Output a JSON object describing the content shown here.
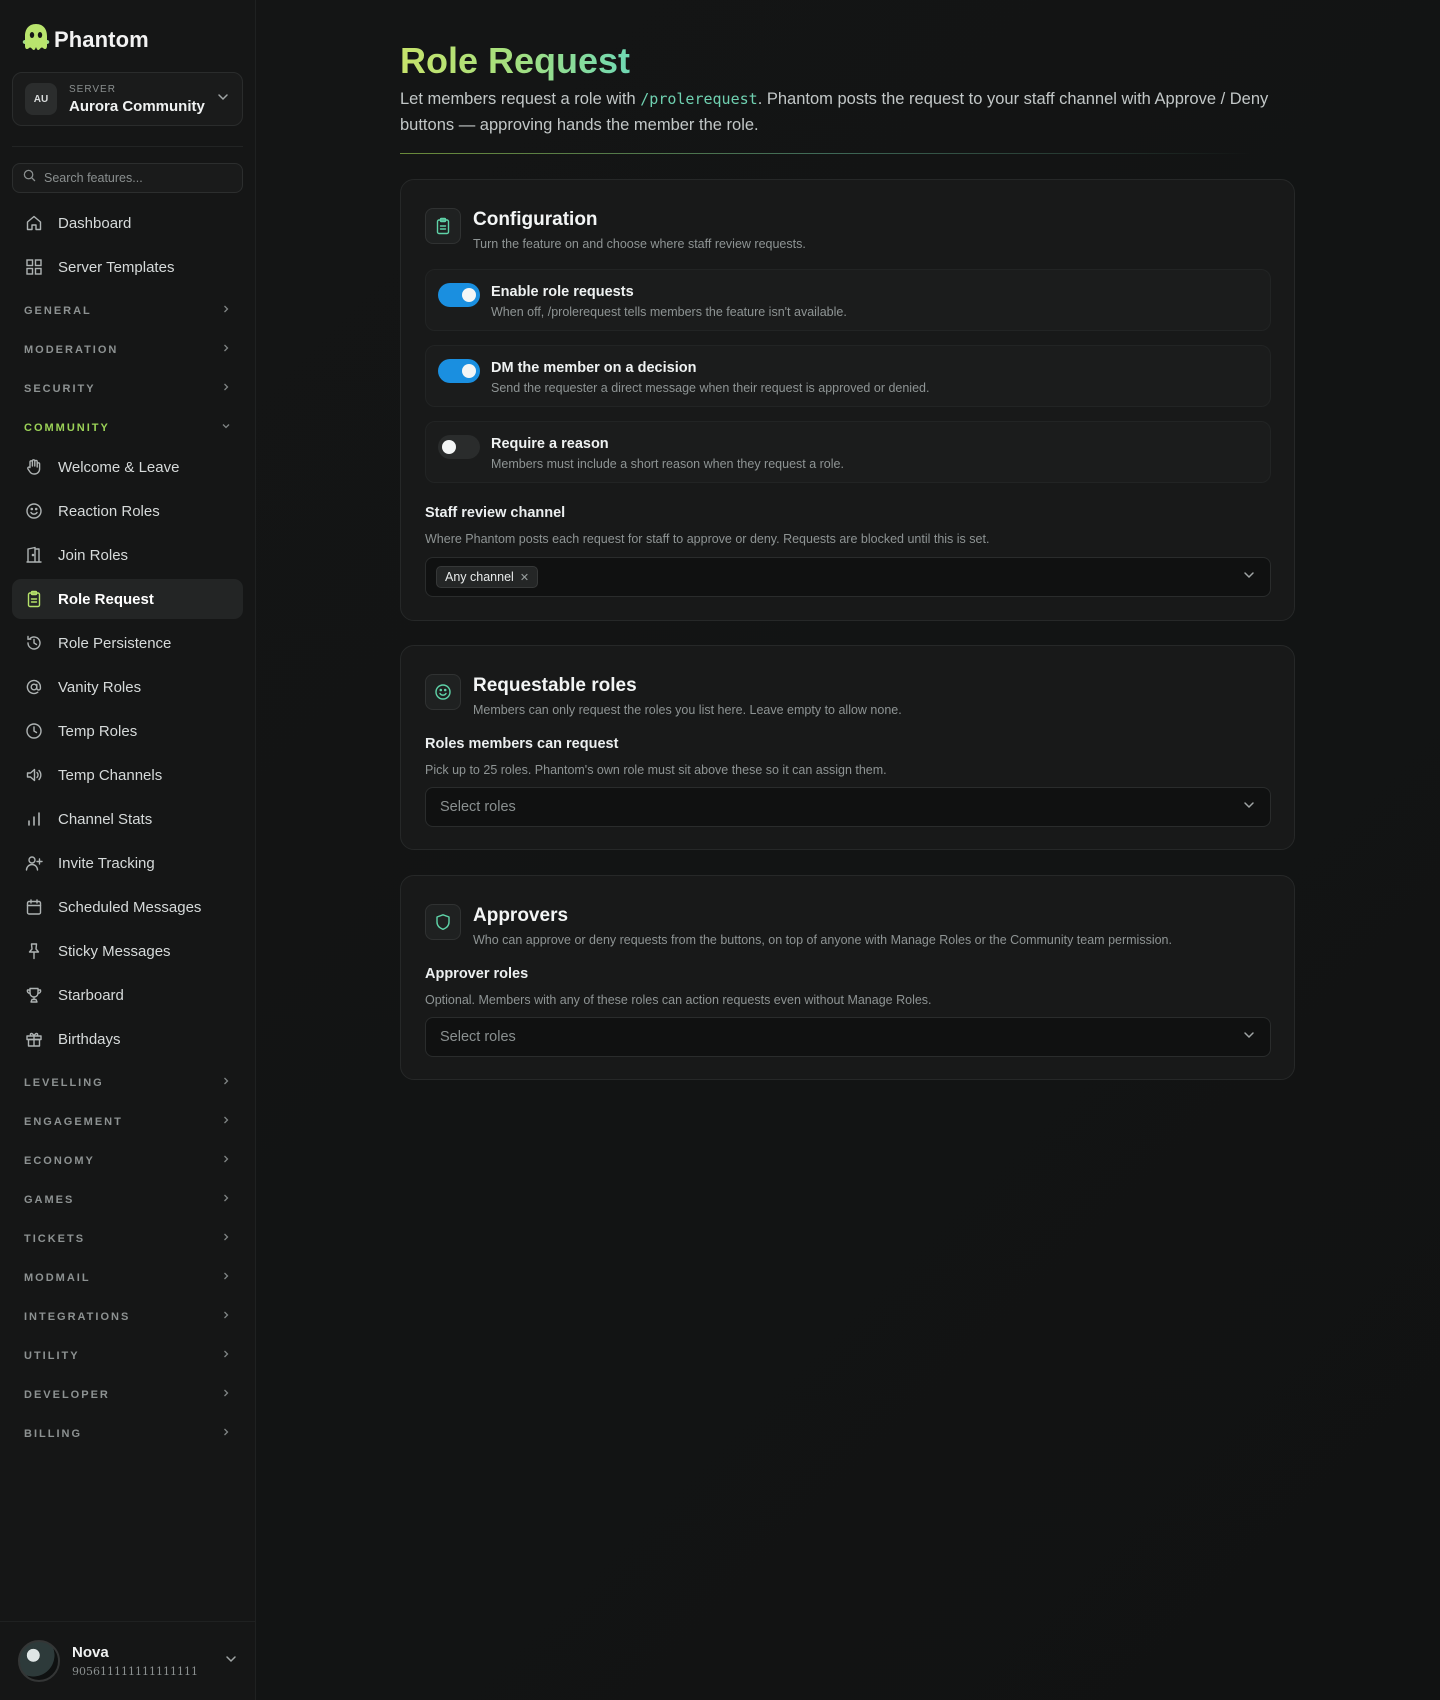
{
  "brand": {
    "name": "Phantom"
  },
  "server": {
    "caption": "SERVER",
    "initials": "AU",
    "name": "Aurora Community"
  },
  "search": {
    "placeholder": "Search features..."
  },
  "nav_top": [
    {
      "label": "Dashboard",
      "icon": "home-icon"
    },
    {
      "label": "Server Templates",
      "icon": "grid-icon"
    }
  ],
  "sections_collapsed_top": [
    "GENERAL",
    "MODERATION",
    "SECURITY"
  ],
  "community": {
    "label": "COMMUNITY",
    "items": [
      {
        "label": "Welcome & Leave",
        "icon": "hand-icon"
      },
      {
        "label": "Reaction Roles",
        "icon": "smile-icon"
      },
      {
        "label": "Join Roles",
        "icon": "door-icon"
      },
      {
        "label": "Role Request",
        "icon": "clipboard-icon",
        "active": true
      },
      {
        "label": "Role Persistence",
        "icon": "history-icon"
      },
      {
        "label": "Vanity Roles",
        "icon": "at-icon"
      },
      {
        "label": "Temp Roles",
        "icon": "clock-icon"
      },
      {
        "label": "Temp Channels",
        "icon": "speaker-icon"
      },
      {
        "label": "Channel Stats",
        "icon": "bar-chart-icon"
      },
      {
        "label": "Invite Tracking",
        "icon": "user-plus-icon"
      },
      {
        "label": "Scheduled Messages",
        "icon": "calendar-icon"
      },
      {
        "label": "Sticky Messages",
        "icon": "pin-icon"
      },
      {
        "label": "Starboard",
        "icon": "trophy-icon"
      },
      {
        "label": "Birthdays",
        "icon": "gift-icon"
      }
    ]
  },
  "sections_collapsed_bottom": [
    "LEVELLING",
    "ENGAGEMENT",
    "ECONOMY",
    "GAMES",
    "TICKETS",
    "MODMAIL",
    "INTEGRATIONS",
    "UTILITY",
    "DEVELOPER",
    "BILLING"
  ],
  "user": {
    "name": "Nova",
    "id": "905611111111111111"
  },
  "page": {
    "title": "Role Request",
    "desc_before": "Let members request a role with ",
    "desc_command": "/prolerequest",
    "desc_after": ". Phantom posts the request to your staff channel with Approve / Deny buttons — approving hands the member the role."
  },
  "configuration": {
    "title": "Configuration",
    "subtitle": "Turn the feature on and choose where staff review requests.",
    "toggles": [
      {
        "title": "Enable role requests",
        "desc": "When off, /prolerequest tells members the feature isn't available.",
        "on": true
      },
      {
        "title": "DM the member on a decision",
        "desc": "Send the requester a direct message when their request is approved or denied.",
        "on": true
      },
      {
        "title": "Require a reason",
        "desc": "Members must include a short reason when they request a role.",
        "on": false
      }
    ],
    "channel_label": "Staff review channel",
    "channel_help": "Where Phantom posts each request for staff to approve or deny. Requests are blocked until this is set.",
    "channel_value": "Any channel"
  },
  "requestable": {
    "title": "Requestable roles",
    "subtitle": "Members can only request the roles you list here. Leave empty to allow none.",
    "field_label": "Roles members can request",
    "field_help": "Pick up to 25 roles. Phantom's own role must sit above these so it can assign them.",
    "placeholder": "Select roles"
  },
  "approvers": {
    "title": "Approvers",
    "subtitle": "Who can approve or deny requests from the buttons, on top of anyone with Manage Roles or the Community team permission.",
    "field_label": "Approver roles",
    "field_help": "Optional. Members with any of these roles can action requests even without Manage Roles.",
    "placeholder": "Select roles"
  },
  "colors": {
    "accent_green": "#9bd257",
    "title_gradient_start": "#c7e36b",
    "title_gradient_end": "#6fd8b3",
    "toggle_on": "#1a8fe0",
    "icon_teal": "#5fd3a8"
  }
}
